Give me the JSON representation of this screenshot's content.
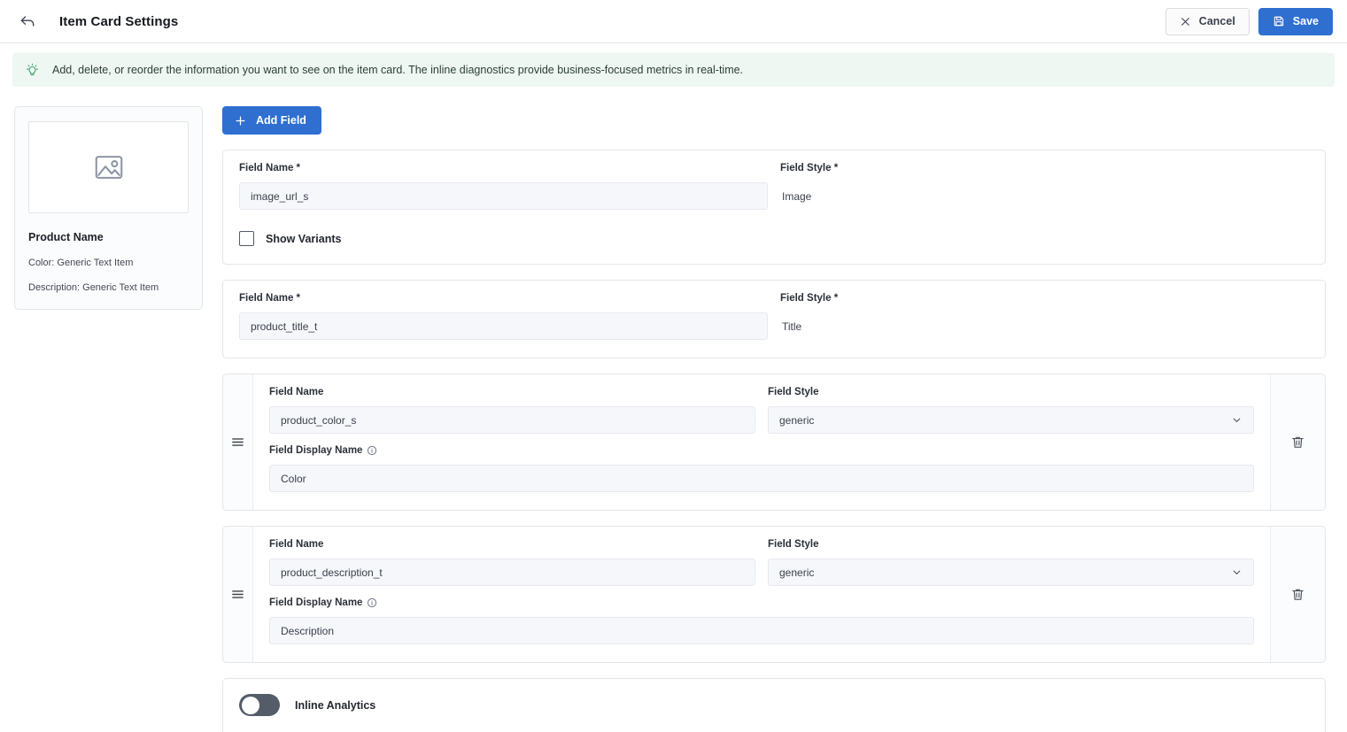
{
  "header": {
    "back_icon": "back-arrow-icon",
    "title": "Item Card Settings",
    "cancel_label": "Cancel",
    "save_label": "Save",
    "accent_color": "#2e6fd0"
  },
  "banner": {
    "icon": "lightbulb-tip-icon",
    "text": "Add, delete, or reorder the information you want to see on the item card. The inline diagnostics provide business-focused metrics in real-time.",
    "background_color": "#eef7f1",
    "icon_color": "#3a9e6b"
  },
  "preview": {
    "image_placeholder_icon": "image-placeholder-icon",
    "product_name": "Product Name",
    "attributes": [
      "Color: Generic Text Item",
      "Description: Generic Text Item"
    ]
  },
  "toolbar": {
    "add_field_label": "Add Field",
    "add_field_icon": "plus-icon"
  },
  "labels": {
    "field_name": "Field Name",
    "field_name_required": "Field Name *",
    "field_style": "Field Style",
    "field_style_required": "Field Style *",
    "field_display_name": "Field Display Name",
    "info_icon": "info-circle-icon",
    "drag_icon": "drag-handle-icon",
    "delete_icon": "trash-icon",
    "chevron_icon": "chevron-down-icon"
  },
  "fields": [
    {
      "field_name": "image_url_s",
      "field_style": "Image",
      "checkbox_label": "Show Variants",
      "checkbox_checked": false
    },
    {
      "field_name": "product_title_t",
      "field_style": "Title"
    },
    {
      "field_name": "product_color_s",
      "field_style": "generic",
      "display_name": "Color"
    },
    {
      "field_name": "product_description_t",
      "field_style": "generic",
      "display_name": "Description"
    }
  ],
  "analytics": {
    "label": "Inline Analytics",
    "enabled": false
  }
}
